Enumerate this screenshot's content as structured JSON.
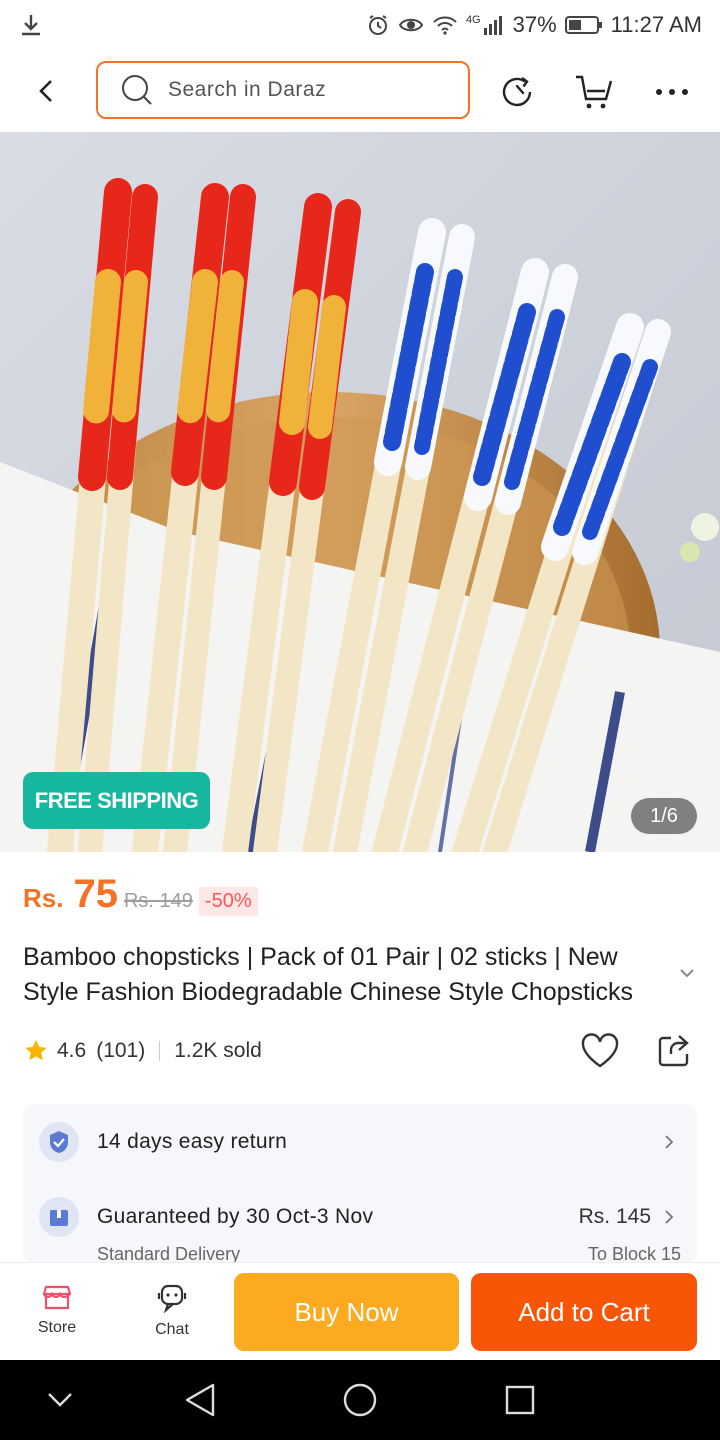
{
  "status_bar": {
    "network": "4G",
    "battery": "37%",
    "time": "11:27 AM"
  },
  "top_bar": {
    "search_placeholder": "Search in Daraz"
  },
  "hero": {
    "badge": "FREE SHIPPING",
    "counter": "1/6"
  },
  "price": {
    "currency": "Rs.",
    "value": "75",
    "original": "Rs. 149",
    "discount": "-50%"
  },
  "product": {
    "title": "Bamboo chopsticks | Pack of 01 Pair | 02 sticks | New Style Fashion Biodegradable Chinese Style Chopsticks",
    "rating": "4.6",
    "reviews": "(101)",
    "sold": "1.2K sold"
  },
  "services": {
    "return": "14 days easy return",
    "delivery": "Guaranteed by 30 Oct-3 Nov",
    "delivery_price": "Rs. 145",
    "delivery_type": "Standard Delivery",
    "delivery_location": "To Block 15"
  },
  "actions": {
    "store": "Store",
    "chat": "Chat",
    "buy_now": "Buy Now",
    "add_to_cart": "Add to Cart"
  },
  "colors": {
    "accent": "#f57224",
    "buy_now": "#fcaa1f",
    "add_to_cart": "#f85606",
    "free_shipping": "#16b79e"
  }
}
